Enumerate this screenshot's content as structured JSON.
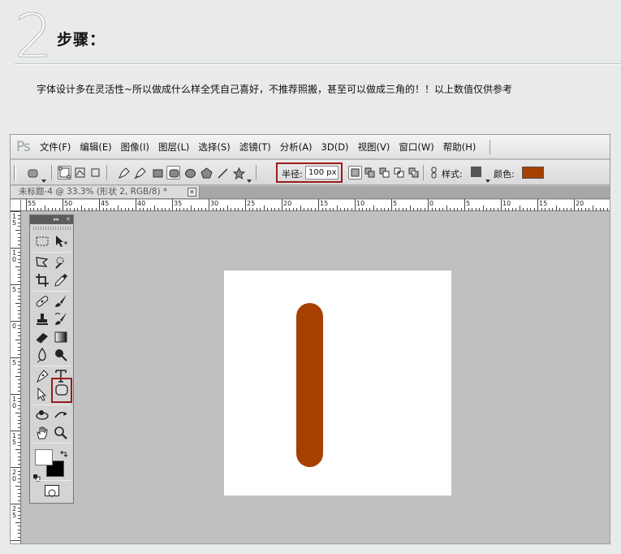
{
  "tutorial": {
    "step_number": "2",
    "step_title": "步骤：",
    "description": "字体设计多在灵活性~所以做成什么样全凭自己喜好，不推荐照搬，甚至可以做成三角的！！以上数值仅供参考"
  },
  "app": {
    "logo": "Ps",
    "menu": [
      {
        "label": "文件(F)"
      },
      {
        "label": "编辑(E)"
      },
      {
        "label": "图像(I)"
      },
      {
        "label": "图层(L)"
      },
      {
        "label": "选择(S)"
      },
      {
        "label": "滤镜(T)"
      },
      {
        "label": "分析(A)"
      },
      {
        "label": "3D(D)"
      },
      {
        "label": "视图(V)"
      },
      {
        "label": "窗口(W)"
      },
      {
        "label": "帮助(H)"
      }
    ]
  },
  "options_bar": {
    "radius_label": "半径:",
    "radius_value": "100 px",
    "style_label": "样式:",
    "color_label": "颜色:",
    "style_swatch_color": "#555555",
    "fill_color": "#a64000"
  },
  "document": {
    "tab_title": "未标题-4 @ 33.3% (形状 2, RGB/8) *",
    "close_glyph": "✕"
  },
  "rulers": {
    "horizontal": [
      "55",
      "50",
      "45",
      "40",
      "35",
      "30",
      "25",
      "20",
      "15",
      "10",
      "5",
      "0",
      "5",
      "10",
      "15",
      "20"
    ],
    "vertical": [
      "15",
      "10",
      "5",
      "0",
      "5",
      "10",
      "15",
      "20",
      "25"
    ]
  },
  "tools_panel": {
    "collapse_glyph": "▸▸",
    "close_glyph": "✕",
    "highlighted_tool": "rounded-rectangle-tool"
  },
  "canvas": {
    "shape_color": "#a64000",
    "background": "#ffffff"
  }
}
